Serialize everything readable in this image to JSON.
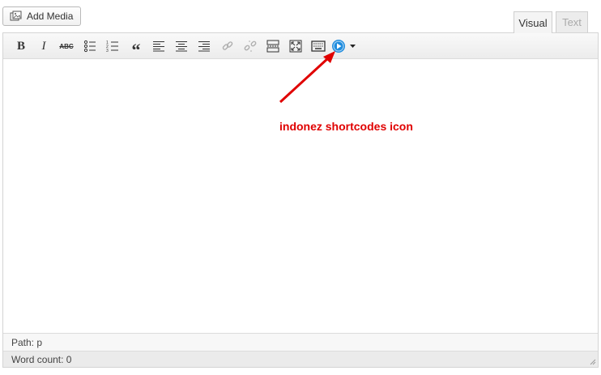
{
  "media": {
    "add_media_label": "Add Media"
  },
  "tabs": {
    "visual": "Visual",
    "text": "Text"
  },
  "toolbar": {
    "bold": "B",
    "italic": "I",
    "strike": "ABC",
    "quote": "“"
  },
  "status": {
    "path": "Path: p",
    "word_count": "Word count: 0"
  },
  "annotation": {
    "text": "indonez shortcodes icon",
    "color": "#e00000"
  },
  "colors": {
    "accent_icon": "#1e8cde"
  }
}
